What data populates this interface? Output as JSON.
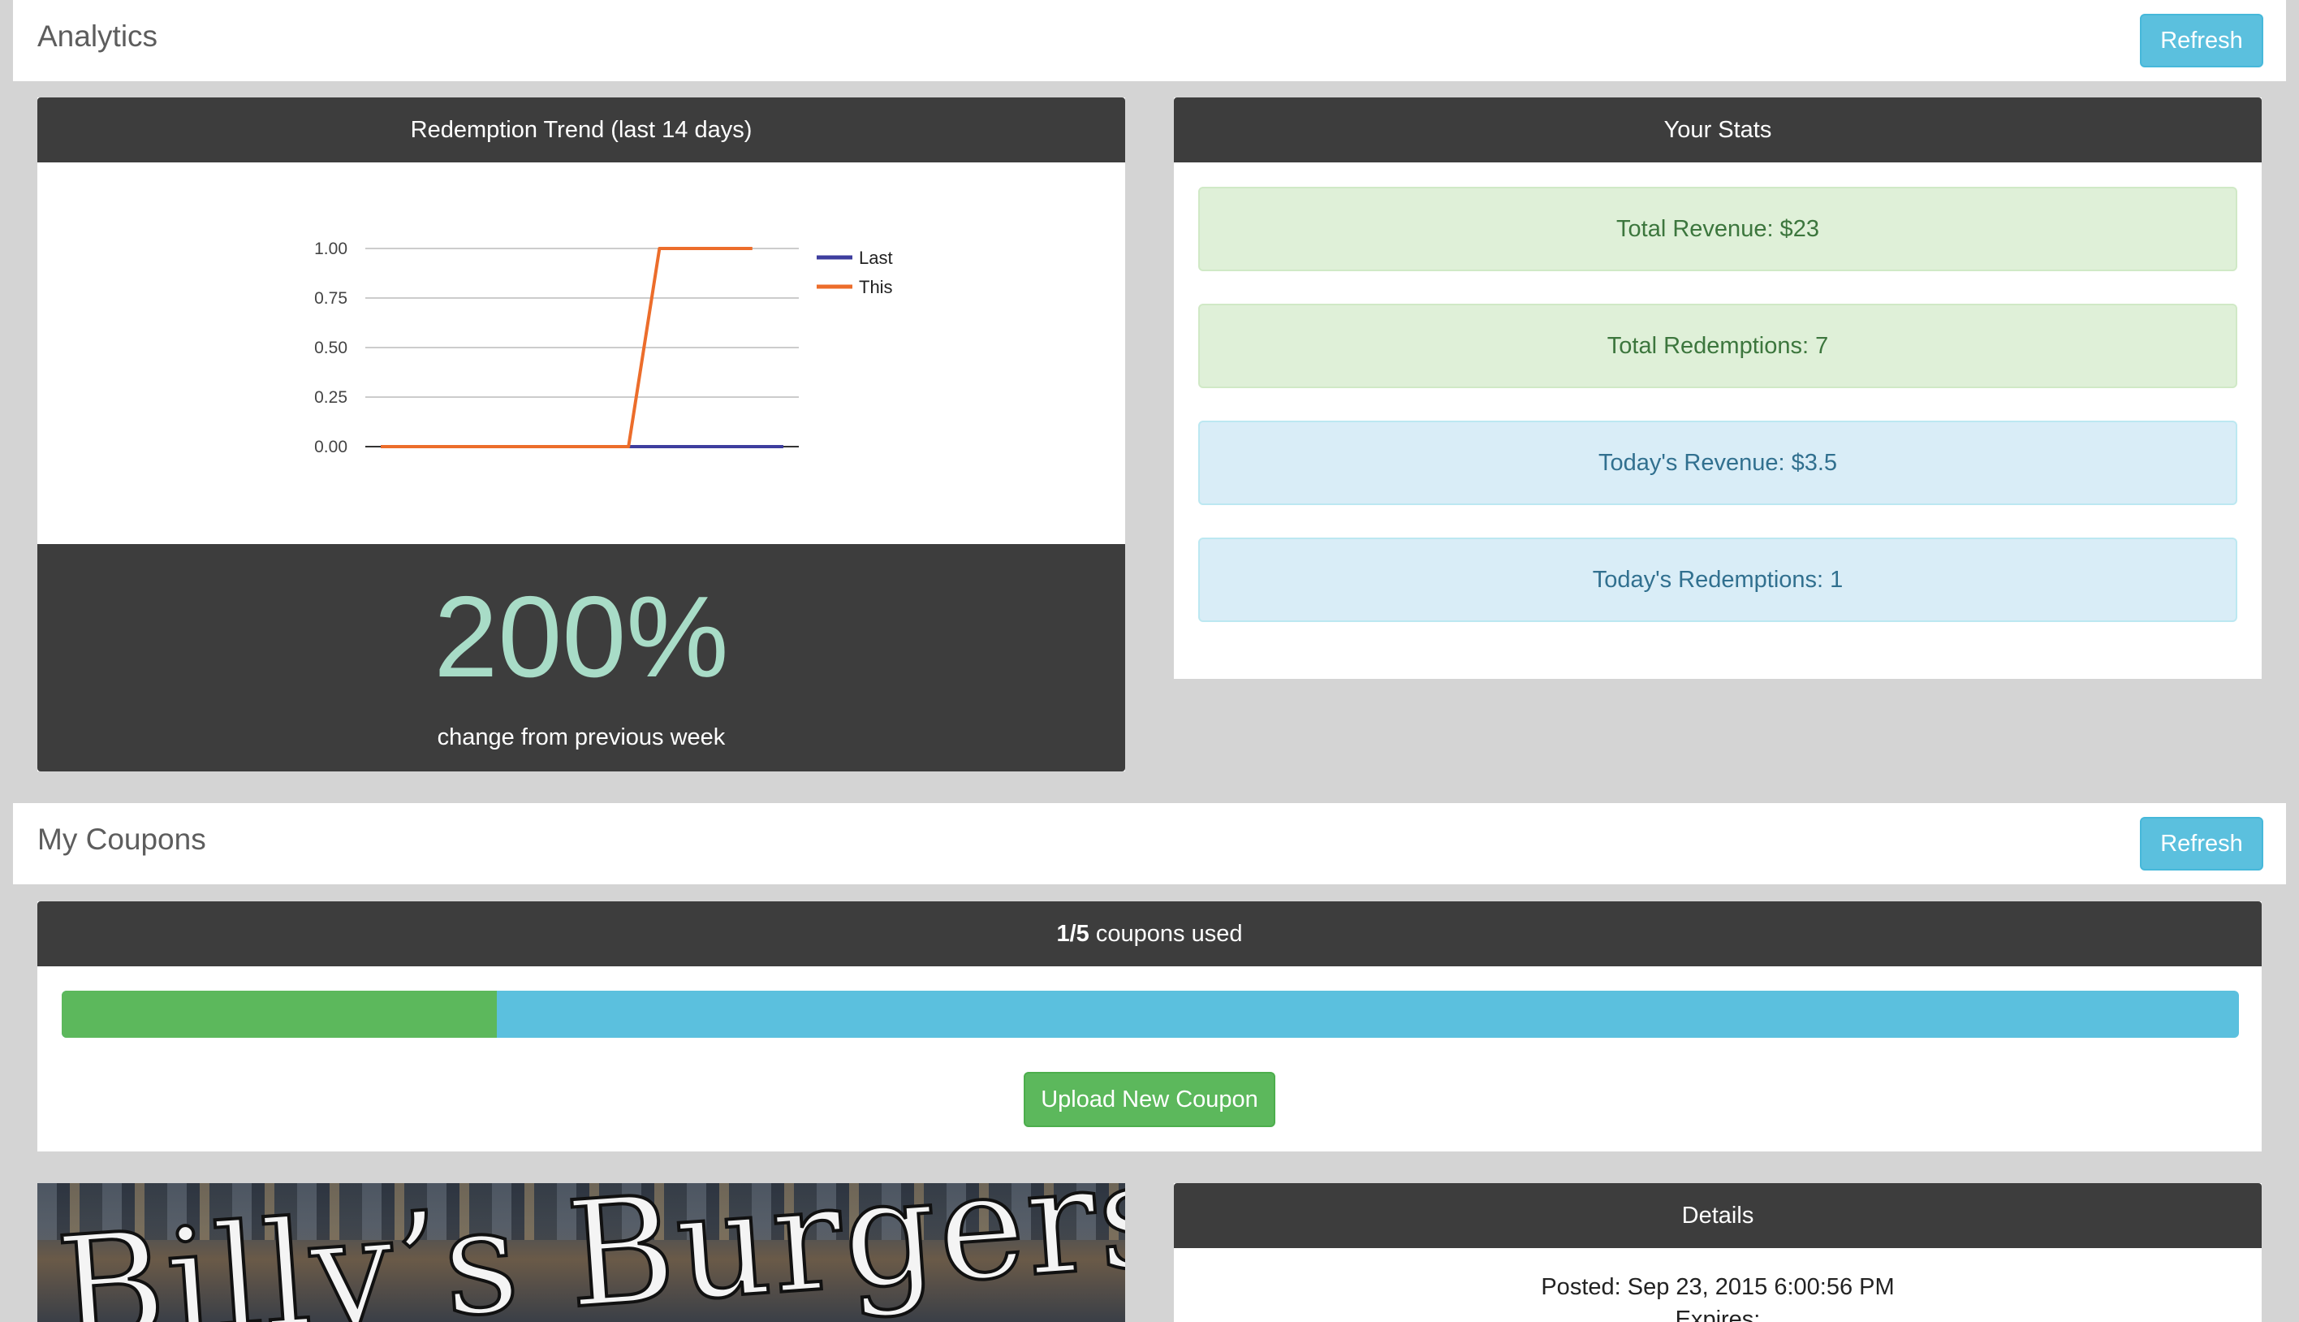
{
  "analytics": {
    "title": "Analytics",
    "refresh_label": "Refresh",
    "trend_panel": {
      "title": "Redemption Trend (last 14 days)",
      "change_value": "200%",
      "change_label": "change from previous week"
    },
    "stats_panel": {
      "title": "Your Stats",
      "items": [
        {
          "label": "Total Revenue: $23",
          "style": "success"
        },
        {
          "label": "Total Redemptions: 7",
          "style": "success"
        },
        {
          "label": "Today's Revenue: $3.5",
          "style": "info"
        },
        {
          "label": "Today's Redemptions: 1",
          "style": "info"
        }
      ]
    }
  },
  "chart_data": {
    "type": "line",
    "x": [
      1,
      2,
      3,
      4,
      5,
      6,
      7,
      8,
      9,
      10,
      11,
      12,
      13,
      14
    ],
    "ylim": [
      0,
      1
    ],
    "yticks": [
      "0.00",
      "0.25",
      "0.50",
      "0.75",
      "1.00"
    ],
    "grid": true,
    "legend_position": "right",
    "series": [
      {
        "name": "Last",
        "color": "#3e3e9e",
        "values": [
          0,
          0,
          0,
          0,
          0,
          0,
          0,
          0,
          0,
          0,
          0,
          0,
          0,
          0
        ]
      },
      {
        "name": "This",
        "color": "#ec6d2b",
        "values": [
          0,
          0,
          0,
          0,
          0,
          0,
          0,
          0,
          0,
          1,
          1,
          1,
          1
        ]
      }
    ]
  },
  "coupons": {
    "title": "My Coupons",
    "refresh_label": "Refresh",
    "usage_bold": "1/5",
    "usage_text": " coupons used",
    "used": 1,
    "total": 5,
    "progress_color_used": "#5cb85c",
    "progress_color_remaining": "#5bc0de",
    "upload_label": "Upload New Coupon",
    "coupon_image_text": "Billy’s Burgers",
    "details": {
      "title": "Details",
      "posted": "Posted: Sep 23, 2015 6:00:56 PM",
      "expires": "Expires:"
    }
  }
}
